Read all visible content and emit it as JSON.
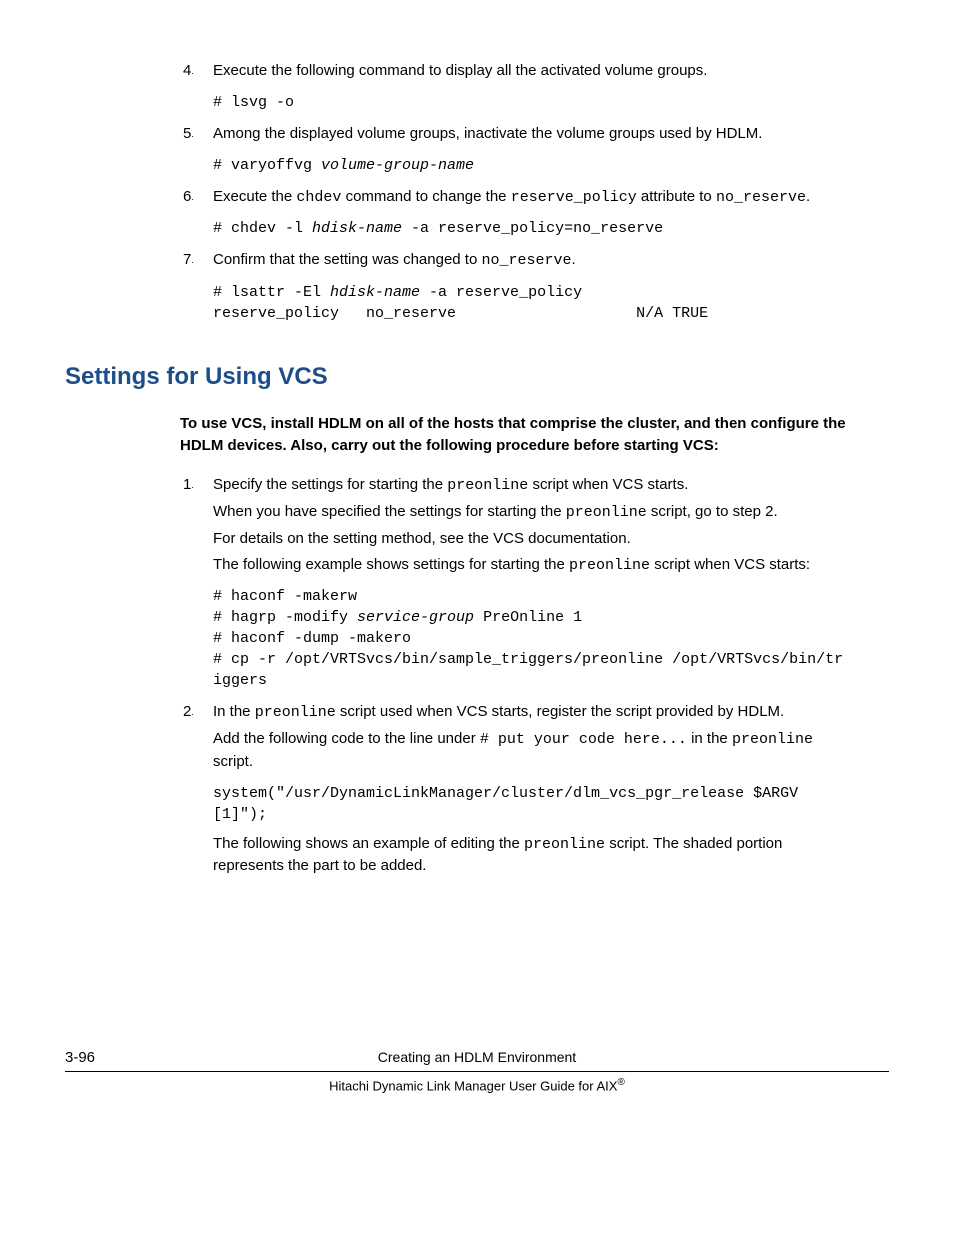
{
  "steps_top": [
    {
      "num": "4",
      "text": "Execute the following command to display all the activated volume groups.",
      "code": "# lsvg -o"
    },
    {
      "num": "5",
      "text": "Among the displayed volume groups, inactivate the volume groups used by HDLM.",
      "code_parts": [
        "# varyoffvg ",
        "volume-group-name"
      ]
    },
    {
      "num": "6",
      "text_parts": [
        "Execute the ",
        "chdev",
        " command to change the ",
        "reserve_policy",
        " attribute to ",
        "no_reserve",
        "."
      ],
      "code_parts": [
        "# chdev -l ",
        "hdisk-name",
        " -a reserve_policy=no_reserve"
      ]
    },
    {
      "num": "7",
      "text_parts": [
        "Confirm that the setting was changed to ",
        "no_reserve",
        "."
      ],
      "code_parts": [
        "# lsattr -El ",
        "hdisk-name",
        " -a reserve_policy\nreserve_policy   no_reserve                    N/A TRUE"
      ]
    }
  ],
  "section_heading": "Settings for Using VCS",
  "intro": "To use VCS, install HDLM on all of the hosts that comprise the cluster, and then configure the HDLM devices. Also, carry out the following procedure before starting VCS:",
  "steps_vcs": {
    "s1": {
      "num": "1",
      "p1_parts": [
        "Specify the settings for starting the ",
        "preonline",
        " script when VCS starts."
      ],
      "p2_parts": [
        "When you have specified the settings for starting the ",
        "preonline",
        " script, go to step 2."
      ],
      "p3": "For details on the setting method, see the VCS documentation.",
      "p4_parts": [
        "The following example shows settings for starting the ",
        "preonline",
        " script when VCS starts:"
      ],
      "code_parts": [
        "# haconf -makerw\n# hagrp -modify ",
        "service-group",
        " PreOnline 1\n# haconf -dump -makero\n# cp -r /opt/VRTSvcs/bin/sample_triggers/preonline /opt/VRTSvcs/bin/triggers"
      ]
    },
    "s2": {
      "num": "2",
      "p1_parts": [
        "In the ",
        "preonline",
        " script used when VCS starts, register the script provided by HDLM."
      ],
      "p2_parts": [
        "Add the following code to the line under ",
        "# put your code here...",
        " in the ",
        "preonline",
        " script."
      ],
      "code": "system(\"/usr/DynamicLinkManager/cluster/dlm_vcs_pgr_release $ARGV[1]\");",
      "p3_parts": [
        "The following shows an example of editing the ",
        "preonline",
        " script. The shaded portion represents the part to be added."
      ]
    }
  },
  "footer": {
    "page": "3-96",
    "line1": "Creating an HDLM Environment",
    "line2_prefix": "Hitachi Dynamic Link Manager User Guide for AIX",
    "line2_suffix": "®"
  }
}
